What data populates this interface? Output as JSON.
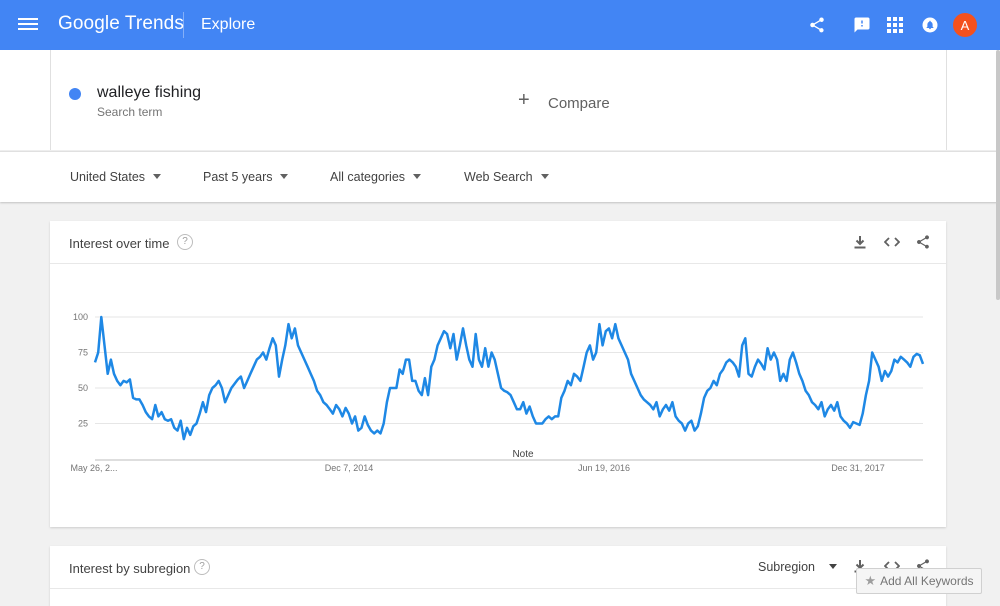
{
  "header": {
    "logo": "Google Trends",
    "title": "Explore",
    "avatar_letter": "A",
    "accent": "#4285f4"
  },
  "search_term": {
    "name": "walleye fishing",
    "subtitle": "Search term",
    "color": "#4285f4"
  },
  "compare": {
    "label": "Compare"
  },
  "filters": [
    {
      "label": "United States"
    },
    {
      "label": "Past 5 years"
    },
    {
      "label": "All categories"
    },
    {
      "label": "Web Search"
    }
  ],
  "interest_over_time": {
    "title": "Interest over time",
    "tools": [
      "download-icon",
      "embed-icon",
      "share-icon"
    ]
  },
  "interest_by_subregion": {
    "title": "Interest by subregion",
    "select_label": "Subregion"
  },
  "add_keywords": {
    "label": "Add All Keywords"
  },
  "chart_data": {
    "type": "line",
    "title": "",
    "xlabel": "",
    "ylabel": "",
    "ylim": [
      0,
      100
    ],
    "yticks": [
      25,
      50,
      75,
      100
    ],
    "grid": true,
    "x_tick_labels": [
      "May 26, 2...",
      "Dec 7, 2014",
      "Jun 19, 2016",
      "Dec 31, 2017"
    ],
    "annotation": "Note",
    "series": [
      {
        "color": "#1e88e5",
        "values": [
          68,
          75,
          100,
          80,
          60,
          70,
          60,
          55,
          52,
          55,
          54,
          56,
          43,
          42,
          42,
          38,
          33,
          30,
          28,
          38,
          30,
          33,
          28,
          27,
          28,
          22,
          20,
          27,
          14,
          22,
          17,
          23,
          25,
          32,
          40,
          33,
          45,
          50,
          52,
          55,
          50,
          40,
          45,
          50,
          53,
          56,
          58,
          50,
          55,
          60,
          65,
          70,
          72,
          75,
          70,
          78,
          85,
          80,
          58,
          70,
          80,
          95,
          85,
          92,
          80,
          75,
          70,
          65,
          60,
          55,
          48,
          45,
          40,
          38,
          35,
          32,
          38,
          35,
          30,
          36,
          32,
          25,
          30,
          20,
          22,
          30,
          24,
          20,
          18,
          20,
          18,
          25,
          40,
          50,
          50,
          50,
          63,
          60,
          70,
          70,
          55,
          55,
          48,
          45,
          57,
          45,
          65,
          70,
          80,
          85,
          90,
          88,
          78,
          88,
          70,
          80,
          92,
          80,
          70,
          65,
          88,
          70,
          65,
          78,
          65,
          75,
          70,
          60,
          50,
          48,
          47,
          45,
          40,
          35,
          35,
          40,
          32,
          37,
          30,
          25,
          25,
          25,
          28,
          30,
          28,
          30,
          30,
          43,
          48,
          55,
          52,
          60,
          58,
          55,
          65,
          75,
          80,
          70,
          75,
          95,
          80,
          90,
          92,
          85,
          95,
          85,
          80,
          75,
          70,
          60,
          55,
          50,
          45,
          42,
          40,
          38,
          35,
          40,
          30,
          35,
          38,
          34,
          40,
          30,
          27,
          25,
          20,
          25,
          27,
          20,
          23,
          32,
          43,
          48,
          50,
          55,
          52,
          60,
          63,
          68,
          70,
          68,
          65,
          58,
          80,
          85,
          60,
          58,
          65,
          70,
          67,
          63,
          78,
          70,
          75,
          70,
          55,
          60,
          55,
          70,
          75,
          68,
          60,
          55,
          48,
          45,
          40,
          38,
          35,
          40,
          30,
          35,
          38,
          34,
          40,
          30,
          27,
          25,
          22,
          26,
          25,
          24,
          32,
          45,
          55,
          75,
          70,
          65,
          55,
          62,
          58,
          62,
          70,
          68,
          72,
          70,
          68,
          65,
          72,
          74,
          73,
          67
        ]
      }
    ]
  }
}
